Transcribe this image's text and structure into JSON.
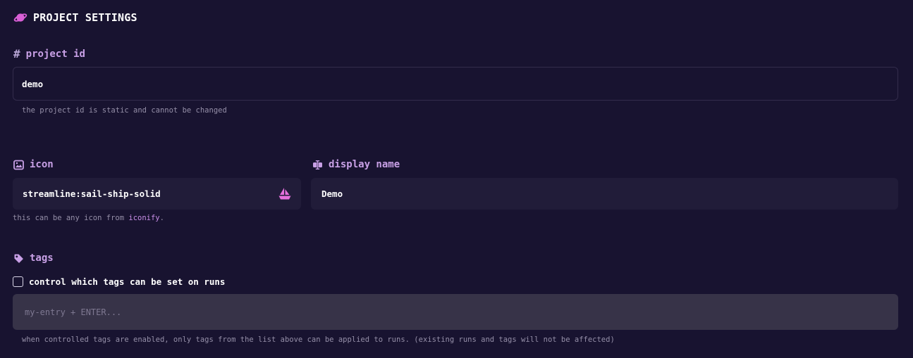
{
  "header": {
    "title": "PROJECT SETTINGS",
    "icon": "planet-icon"
  },
  "project_id": {
    "label": "project id",
    "label_icon": "#",
    "value": "demo",
    "hint": "the project id is static and cannot be changed"
  },
  "icon_field": {
    "label": "icon",
    "label_icon": "image-icon",
    "value": "streamline:sail-ship-solid",
    "preview_icon": "sail-ship-icon",
    "hint_prefix": "this can be any icon from ",
    "hint_link": "iconify",
    "hint_suffix": "."
  },
  "display_name": {
    "label": "display name",
    "label_icon": "text-cursor-icon",
    "value": "Demo"
  },
  "tags": {
    "label": "tags",
    "label_icon": "tag-icon",
    "checkbox_label": "control which tags can be set on runs",
    "checked": false,
    "placeholder": "my-entry + ENTER...",
    "hint": "when controlled tags are enabled, only tags from the list above can be applied to runs. (existing runs and tags will not be affected)"
  },
  "colors": {
    "background": "#181330",
    "accent": "#d95fd6",
    "label": "#c8a0e6"
  }
}
